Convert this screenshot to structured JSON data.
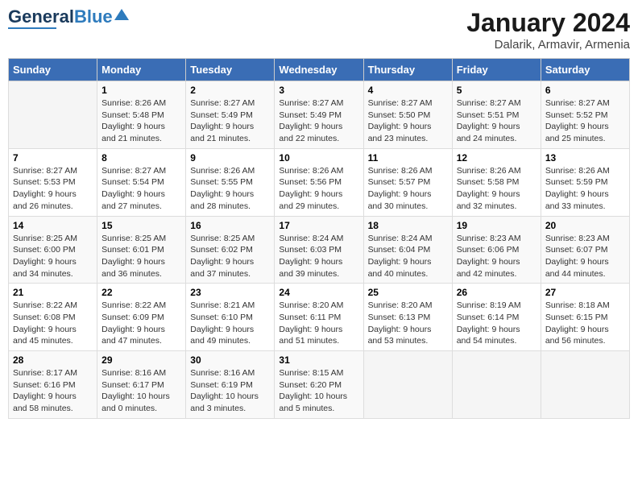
{
  "header": {
    "logo_general": "General",
    "logo_blue": "Blue",
    "month": "January 2024",
    "location": "Dalarik, Armavir, Armenia"
  },
  "days_of_week": [
    "Sunday",
    "Monday",
    "Tuesday",
    "Wednesday",
    "Thursday",
    "Friday",
    "Saturday"
  ],
  "weeks": [
    [
      {
        "day": "",
        "info": ""
      },
      {
        "day": "1",
        "info": "Sunrise: 8:26 AM\nSunset: 5:48 PM\nDaylight: 9 hours\nand 21 minutes."
      },
      {
        "day": "2",
        "info": "Sunrise: 8:27 AM\nSunset: 5:49 PM\nDaylight: 9 hours\nand 21 minutes."
      },
      {
        "day": "3",
        "info": "Sunrise: 8:27 AM\nSunset: 5:49 PM\nDaylight: 9 hours\nand 22 minutes."
      },
      {
        "day": "4",
        "info": "Sunrise: 8:27 AM\nSunset: 5:50 PM\nDaylight: 9 hours\nand 23 minutes."
      },
      {
        "day": "5",
        "info": "Sunrise: 8:27 AM\nSunset: 5:51 PM\nDaylight: 9 hours\nand 24 minutes."
      },
      {
        "day": "6",
        "info": "Sunrise: 8:27 AM\nSunset: 5:52 PM\nDaylight: 9 hours\nand 25 minutes."
      }
    ],
    [
      {
        "day": "7",
        "info": "Sunrise: 8:27 AM\nSunset: 5:53 PM\nDaylight: 9 hours\nand 26 minutes."
      },
      {
        "day": "8",
        "info": "Sunrise: 8:27 AM\nSunset: 5:54 PM\nDaylight: 9 hours\nand 27 minutes."
      },
      {
        "day": "9",
        "info": "Sunrise: 8:26 AM\nSunset: 5:55 PM\nDaylight: 9 hours\nand 28 minutes."
      },
      {
        "day": "10",
        "info": "Sunrise: 8:26 AM\nSunset: 5:56 PM\nDaylight: 9 hours\nand 29 minutes."
      },
      {
        "day": "11",
        "info": "Sunrise: 8:26 AM\nSunset: 5:57 PM\nDaylight: 9 hours\nand 30 minutes."
      },
      {
        "day": "12",
        "info": "Sunrise: 8:26 AM\nSunset: 5:58 PM\nDaylight: 9 hours\nand 32 minutes."
      },
      {
        "day": "13",
        "info": "Sunrise: 8:26 AM\nSunset: 5:59 PM\nDaylight: 9 hours\nand 33 minutes."
      }
    ],
    [
      {
        "day": "14",
        "info": "Sunrise: 8:25 AM\nSunset: 6:00 PM\nDaylight: 9 hours\nand 34 minutes."
      },
      {
        "day": "15",
        "info": "Sunrise: 8:25 AM\nSunset: 6:01 PM\nDaylight: 9 hours\nand 36 minutes."
      },
      {
        "day": "16",
        "info": "Sunrise: 8:25 AM\nSunset: 6:02 PM\nDaylight: 9 hours\nand 37 minutes."
      },
      {
        "day": "17",
        "info": "Sunrise: 8:24 AM\nSunset: 6:03 PM\nDaylight: 9 hours\nand 39 minutes."
      },
      {
        "day": "18",
        "info": "Sunrise: 8:24 AM\nSunset: 6:04 PM\nDaylight: 9 hours\nand 40 minutes."
      },
      {
        "day": "19",
        "info": "Sunrise: 8:23 AM\nSunset: 6:06 PM\nDaylight: 9 hours\nand 42 minutes."
      },
      {
        "day": "20",
        "info": "Sunrise: 8:23 AM\nSunset: 6:07 PM\nDaylight: 9 hours\nand 44 minutes."
      }
    ],
    [
      {
        "day": "21",
        "info": "Sunrise: 8:22 AM\nSunset: 6:08 PM\nDaylight: 9 hours\nand 45 minutes."
      },
      {
        "day": "22",
        "info": "Sunrise: 8:22 AM\nSunset: 6:09 PM\nDaylight: 9 hours\nand 47 minutes."
      },
      {
        "day": "23",
        "info": "Sunrise: 8:21 AM\nSunset: 6:10 PM\nDaylight: 9 hours\nand 49 minutes."
      },
      {
        "day": "24",
        "info": "Sunrise: 8:20 AM\nSunset: 6:11 PM\nDaylight: 9 hours\nand 51 minutes."
      },
      {
        "day": "25",
        "info": "Sunrise: 8:20 AM\nSunset: 6:13 PM\nDaylight: 9 hours\nand 53 minutes."
      },
      {
        "day": "26",
        "info": "Sunrise: 8:19 AM\nSunset: 6:14 PM\nDaylight: 9 hours\nand 54 minutes."
      },
      {
        "day": "27",
        "info": "Sunrise: 8:18 AM\nSunset: 6:15 PM\nDaylight: 9 hours\nand 56 minutes."
      }
    ],
    [
      {
        "day": "28",
        "info": "Sunrise: 8:17 AM\nSunset: 6:16 PM\nDaylight: 9 hours\nand 58 minutes."
      },
      {
        "day": "29",
        "info": "Sunrise: 8:16 AM\nSunset: 6:17 PM\nDaylight: 10 hours\nand 0 minutes."
      },
      {
        "day": "30",
        "info": "Sunrise: 8:16 AM\nSunset: 6:19 PM\nDaylight: 10 hours\nand 3 minutes."
      },
      {
        "day": "31",
        "info": "Sunrise: 8:15 AM\nSunset: 6:20 PM\nDaylight: 10 hours\nand 5 minutes."
      },
      {
        "day": "",
        "info": ""
      },
      {
        "day": "",
        "info": ""
      },
      {
        "day": "",
        "info": ""
      }
    ]
  ]
}
